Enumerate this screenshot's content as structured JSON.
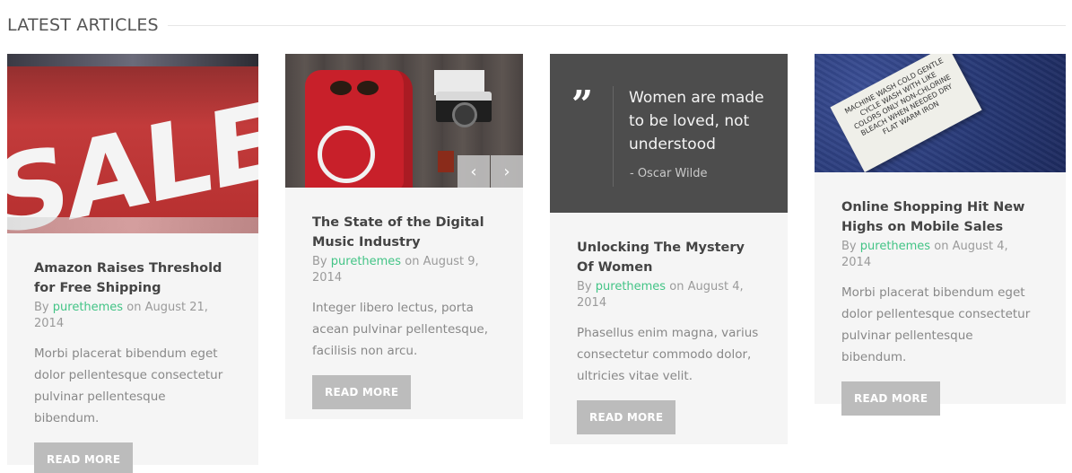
{
  "section": {
    "title": "LATEST ARTICLES"
  },
  "articles": [
    {
      "image_text": "SALE SAL",
      "title": "Amazon Raises Threshold for Free Shipping",
      "by": "By",
      "author": "purethemes",
      "date_prefix": "on",
      "date": "August 21, 2014",
      "excerpt": "Morbi placerat bibendum eget dolor pellentesque consectetur pulvinar pellentesque bibendum.",
      "button": "READ MORE"
    },
    {
      "title": "The State of the Digital Music Industry",
      "by": "By",
      "author": "purethemes",
      "date_prefix": "on",
      "date": "August 9, 2014",
      "excerpt": "Integer libero lectus, porta acean pulvinar pellentesque, facilisis non arcu.",
      "button": "READ MORE",
      "slider": {
        "prev": "‹",
        "next": "›"
      }
    },
    {
      "quote": {
        "mark": "”",
        "text": "Women are made to be loved, not understood",
        "author": "- Oscar Wilde"
      },
      "title": "Unlocking The Mystery Of Women",
      "by": "By",
      "author": "purethemes",
      "date_prefix": "on",
      "date": "August 4, 2014",
      "excerpt": "Phasellus enim magna, varius consectetur commodo dolor, ultricies vitae velit.",
      "button": "READ MORE"
    },
    {
      "image_text": "MACHINE WASH COLD GENTLE CYCLE WASH WITH LIKE COLORS ONLY NON-CHLORINE BLEACH WHEN NEEDED DRY FLAT WARM IRON",
      "title": "Online Shopping Hit New Highs on Mobile Sales",
      "by": "By",
      "author": "purethemes",
      "date_prefix": "on",
      "date": "August 4, 2014",
      "excerpt": "Morbi placerat bibendum eget dolor pellentesque consectetur pulvinar pellentesque bibendum.",
      "button": "READ MORE"
    }
  ],
  "colors": {
    "author": "#43c486",
    "card_bg": "#f5f5f5",
    "button_bg": "#bcbcbc",
    "quote_bg": "#4d4d4d"
  }
}
